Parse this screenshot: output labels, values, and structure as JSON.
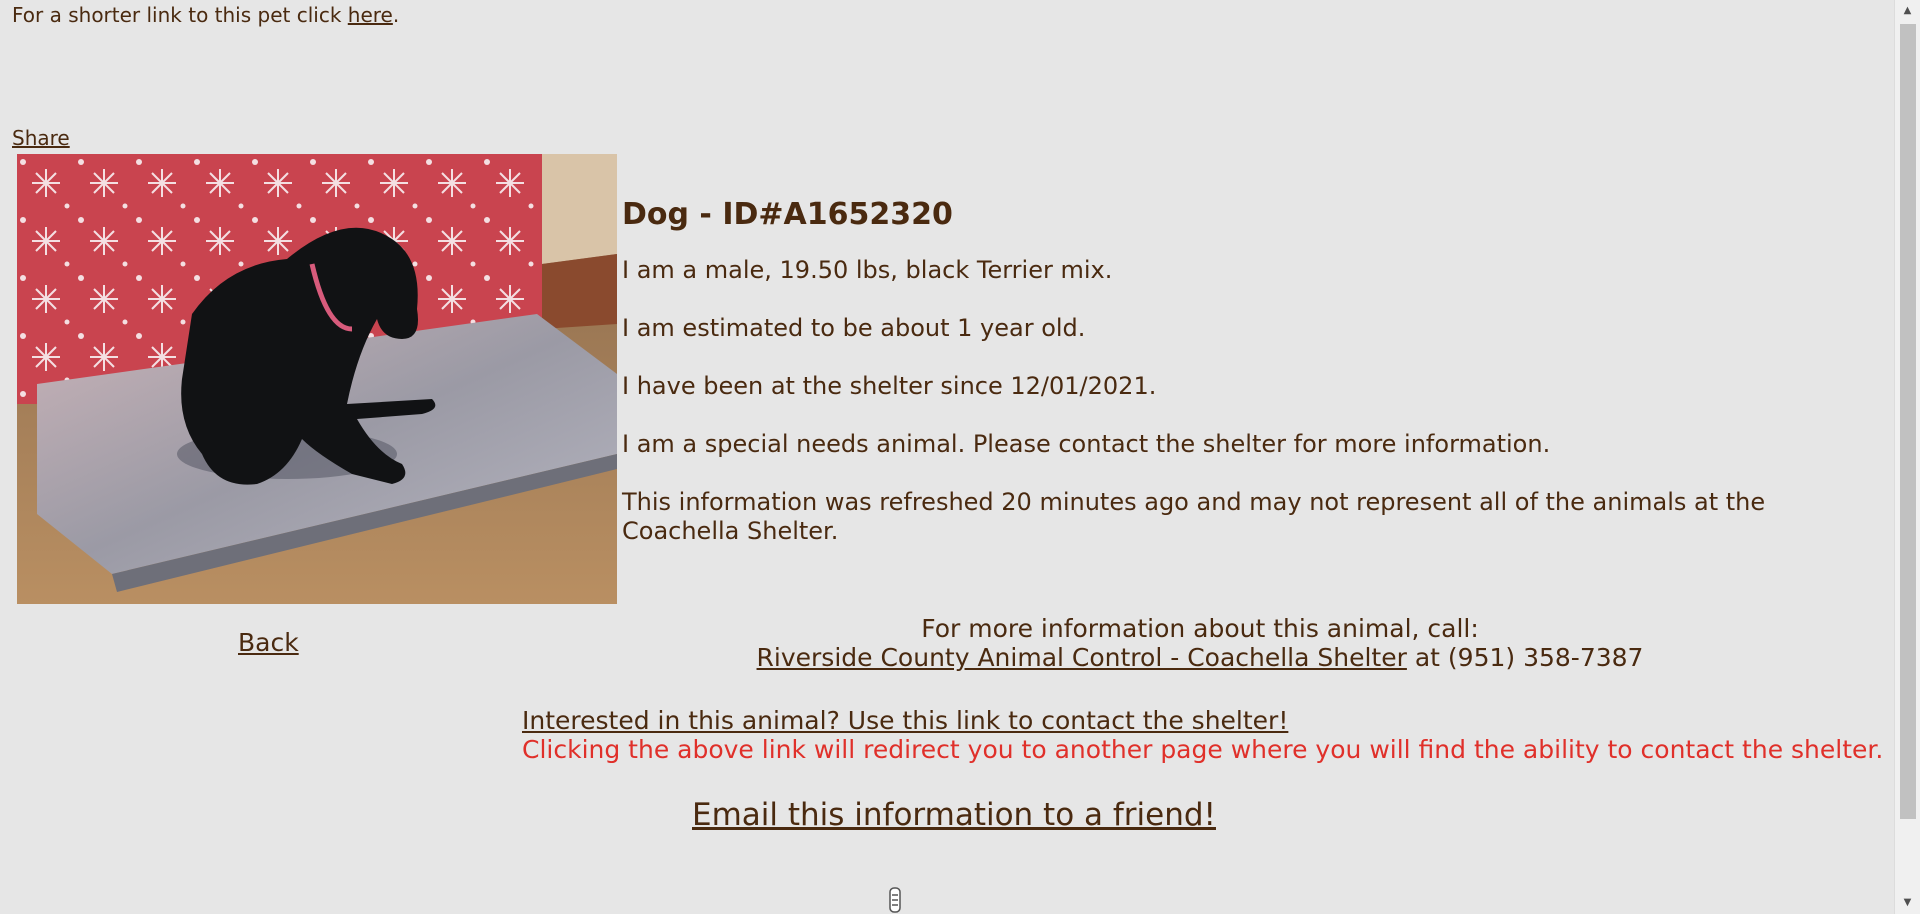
{
  "short_link": {
    "text": "For a shorter link to this pet click ",
    "link": "here",
    "end": "."
  },
  "share_label": "Share",
  "animal": {
    "title": "Dog - ID#A1652320",
    "details": [
      "I am a male, 19.50 lbs, black Terrier mix.",
      "I am estimated to be about 1 year old.",
      "I have been at the shelter since 12/01/2021.",
      "I am a special needs animal. Please contact the shelter for more information.",
      "This information was refreshed 20 minutes ago and may not represent all of the animals at the Coachella Shelter."
    ]
  },
  "back_label": "Back",
  "call": {
    "intro": "For more information about this animal, call:",
    "shelter_link": "Riverside County Animal Control - Coachella Shelter",
    "phone": " at (951) 358-7387"
  },
  "contact": {
    "link": "Interested in this animal? Use this link to contact the shelter!",
    "note": "Clicking the above link will redirect you to another page where you will find the ability to contact the shelter."
  },
  "email_label": "Email this information to a friend!",
  "colors": {
    "background": "#e6e6e6",
    "text": "#4a2a10",
    "warning": "#e0302a"
  }
}
